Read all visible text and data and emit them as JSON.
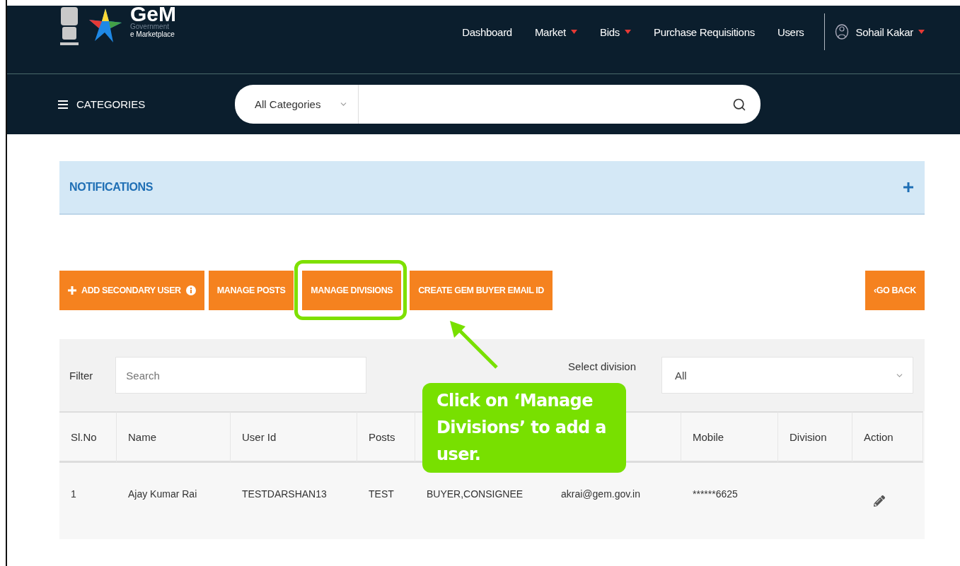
{
  "header": {
    "logo": {
      "name": "GeM",
      "line_1": "Government",
      "line_2": "e Marketplace"
    },
    "nav": [
      {
        "label": "Dashboard",
        "dropdown": false
      },
      {
        "label": "Market",
        "dropdown": true
      },
      {
        "label": "Bids",
        "dropdown": true
      },
      {
        "label": "Purchase Requisitions",
        "dropdown": false
      },
      {
        "label": "Users",
        "dropdown": false
      }
    ],
    "user": {
      "name": "Sohail Kakar"
    },
    "categories_label": "CATEGORIES",
    "search": {
      "category": "All Categories"
    }
  },
  "notifications": {
    "title": "NOTIFICATIONS",
    "expanded": false
  },
  "actions": [
    {
      "label": "ADD SECONDARY USER",
      "kind": "add"
    },
    {
      "label": "MANAGE POSTS",
      "kind": "plain"
    },
    {
      "label": "MANAGE DIVISIONS",
      "kind": "highlighted"
    },
    {
      "label": "CREATE GEM BUYER EMAIL ID",
      "kind": "plain"
    }
  ],
  "go_back": "‹GO BACK",
  "filter": {
    "label": "Filter",
    "placeholder": "Search",
    "division_label": "Select division",
    "division_value": "All"
  },
  "table": {
    "columns": [
      "Sl.No",
      "Name",
      "User Id",
      "Posts",
      null,
      null,
      "Mobile",
      "Division",
      "Action"
    ],
    "rows": [
      {
        "cells": [
          "1",
          "Ajay Kumar Rai",
          "TESTDARSHAN13",
          "TEST",
          "BUYER,CONSIGNEE",
          "akrai@gem.gov.in",
          "******6625",
          null
        ],
        "editable": true
      }
    ]
  },
  "callout": {
    "text": "Click on ‘Manage Divisions’ to add a user."
  }
}
